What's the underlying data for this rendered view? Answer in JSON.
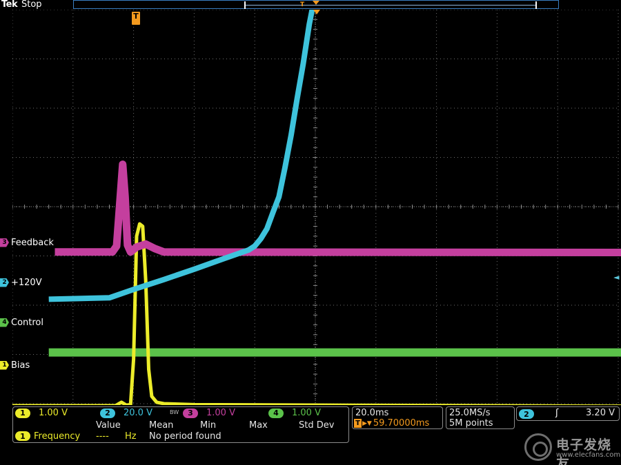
{
  "top_bar": {
    "brand": "Tek",
    "acquisition_state": "Stop",
    "record_trigger_glyph": "T"
  },
  "trigger_marker_glyph": "T",
  "trigger_level_glyph": "◄",
  "channels": {
    "ch1": {
      "number": "1",
      "label": "Bias",
      "scale": "1.00 V",
      "color": "#ecec2a"
    },
    "ch2": {
      "number": "2",
      "label": "+120V",
      "scale": "20.0 V",
      "color": "#3ec3dc"
    },
    "ch3": {
      "number": "3",
      "label": "Feedback",
      "scale": "1.00 V",
      "color": "#c43f9e"
    },
    "ch4": {
      "number": "4",
      "label": "Control",
      "scale": "1.00 V",
      "color": "#5bc24a"
    }
  },
  "bandwidth_icon": "BW",
  "measurements": {
    "headers": {
      "value": "Value",
      "mean": "Mean",
      "min": "Min",
      "max": "Max",
      "std_dev": "Std Dev"
    },
    "row": {
      "source": "1",
      "name": "Frequency",
      "value": "----",
      "unit": "Hz",
      "status": "No period found"
    }
  },
  "horizontal": {
    "scale": "20.0ms",
    "position_icon": "T",
    "position_arrow": "▶▼",
    "position": "59.70000ms"
  },
  "acquisition": {
    "sample_rate": "25.0MS/s",
    "record_length": "5M points"
  },
  "trigger": {
    "source": "2",
    "slope_icon": "rising-edge-icon",
    "slope_glyph": "ʃ",
    "level": "3.20 V"
  },
  "watermark": {
    "text": "电子发烧友",
    "url": "www.elecfans.com"
  },
  "colors": {
    "background": "#000000",
    "grid": "#6f6f6f",
    "trigger_orange": "#f39a1e",
    "ch1": "#ecec2a",
    "ch2": "#3ec3dc",
    "ch3": "#c43f9e",
    "ch4": "#5bc24a"
  },
  "waveforms": {
    "x_unit": "divisions",
    "y_unit": "divisions",
    "ch1": [
      [
        -0.05,
        -4.04
      ],
      [
        1.7,
        -4.04
      ],
      [
        1.8,
        -3.97
      ],
      [
        1.88,
        -4.03
      ],
      [
        1.95,
        -4.02
      ],
      [
        2.0,
        -3.1
      ],
      [
        2.05,
        -0.6
      ],
      [
        2.1,
        -0.35
      ],
      [
        2.15,
        -0.4
      ],
      [
        2.2,
        -1.5
      ],
      [
        2.25,
        -3.3
      ],
      [
        2.3,
        -3.85
      ],
      [
        2.38,
        -3.97
      ],
      [
        2.5,
        -4.0
      ],
      [
        3.0,
        -4.02
      ],
      [
        10.05,
        -4.05
      ]
    ],
    "ch2": [
      [
        0.6,
        -1.88
      ],
      [
        1.6,
        -1.85
      ],
      [
        2.0,
        -1.68
      ],
      [
        2.5,
        -1.48
      ],
      [
        3.0,
        -1.27
      ],
      [
        3.5,
        -1.05
      ],
      [
        3.9,
        -0.88
      ],
      [
        4.0,
        -0.8
      ],
      [
        4.1,
        -0.65
      ],
      [
        4.2,
        -0.45
      ],
      [
        4.3,
        -0.12
      ],
      [
        4.4,
        0.2
      ],
      [
        4.5,
        0.8
      ],
      [
        4.6,
        1.45
      ],
      [
        4.7,
        2.2
      ],
      [
        4.8,
        2.9
      ],
      [
        4.9,
        3.7
      ],
      [
        4.98,
        4.2
      ],
      [
        5.0,
        4.26
      ],
      [
        10.05,
        4.26
      ]
    ],
    "ch3": [
      [
        0.7,
        -0.92
      ],
      [
        1.65,
        -0.92
      ],
      [
        1.72,
        -0.8
      ],
      [
        1.78,
        0.2
      ],
      [
        1.82,
        0.86
      ],
      [
        1.86,
        0.2
      ],
      [
        1.9,
        -0.78
      ],
      [
        1.95,
        -0.92
      ],
      [
        2.05,
        -0.82
      ],
      [
        2.2,
        -0.76
      ],
      [
        2.35,
        -0.85
      ],
      [
        2.5,
        -0.92
      ],
      [
        10.05,
        -0.93
      ]
    ],
    "ch4": [
      [
        0.6,
        -2.96
      ],
      [
        10.05,
        -2.96
      ]
    ]
  }
}
